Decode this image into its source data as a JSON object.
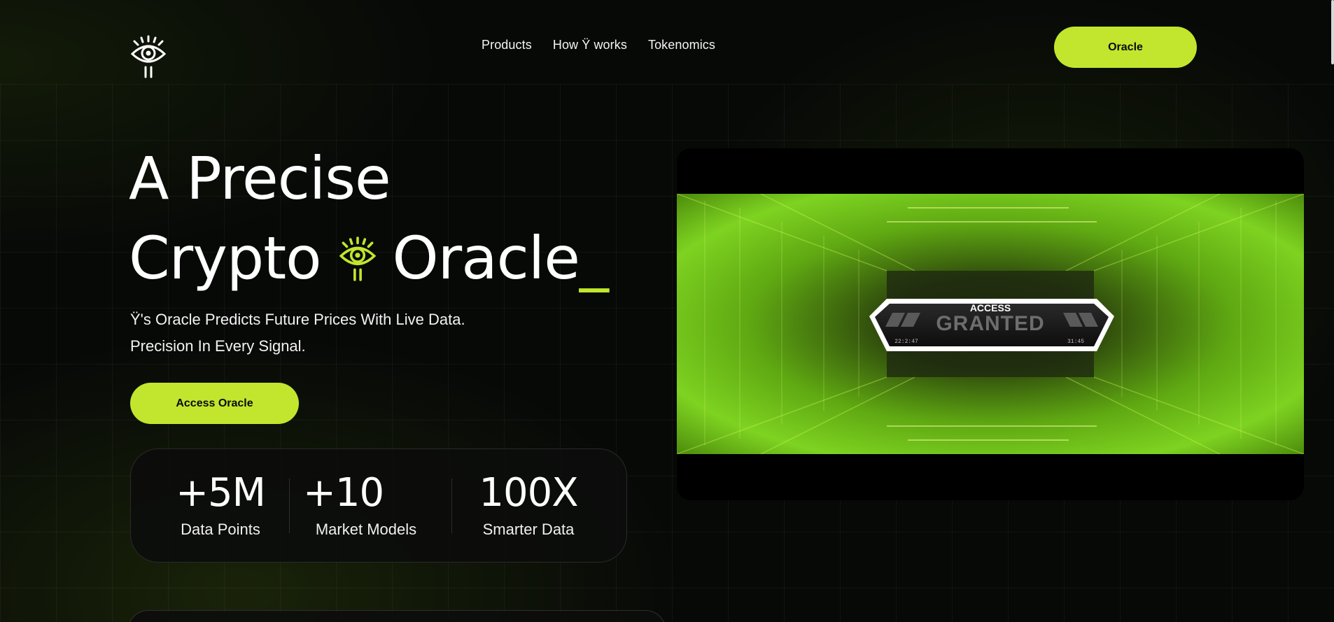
{
  "nav": {
    "logo_icon": "eye-icon",
    "links": [
      "Products",
      "How Ÿ works",
      "Tokenomics"
    ],
    "cta_label": "Oracle"
  },
  "hero": {
    "title_line1": "A Precise",
    "title_line2_left": "Crypto",
    "title_icon": "eye-icon",
    "title_line2_right": "Oracle",
    "cursor": "_",
    "subtitle_line1": "Ÿ's Oracle Predicts Future Prices With Live Data.",
    "subtitle_line2": "Precision In Every Signal.",
    "cta_label": "Access Oracle"
  },
  "stats": [
    {
      "value": "+5M",
      "label": "Data Points"
    },
    {
      "value": "+10",
      "label": "Market Models"
    },
    {
      "value": "100X",
      "label": "Smarter Data"
    }
  ],
  "video": {
    "badge_top": "ACCESS",
    "badge_main": "GRANTED",
    "time_left": "22:2:47",
    "time_right": "31:45"
  },
  "colors": {
    "accent": "#c1e62d",
    "background": "#070907",
    "card": "#0c0d0c"
  }
}
